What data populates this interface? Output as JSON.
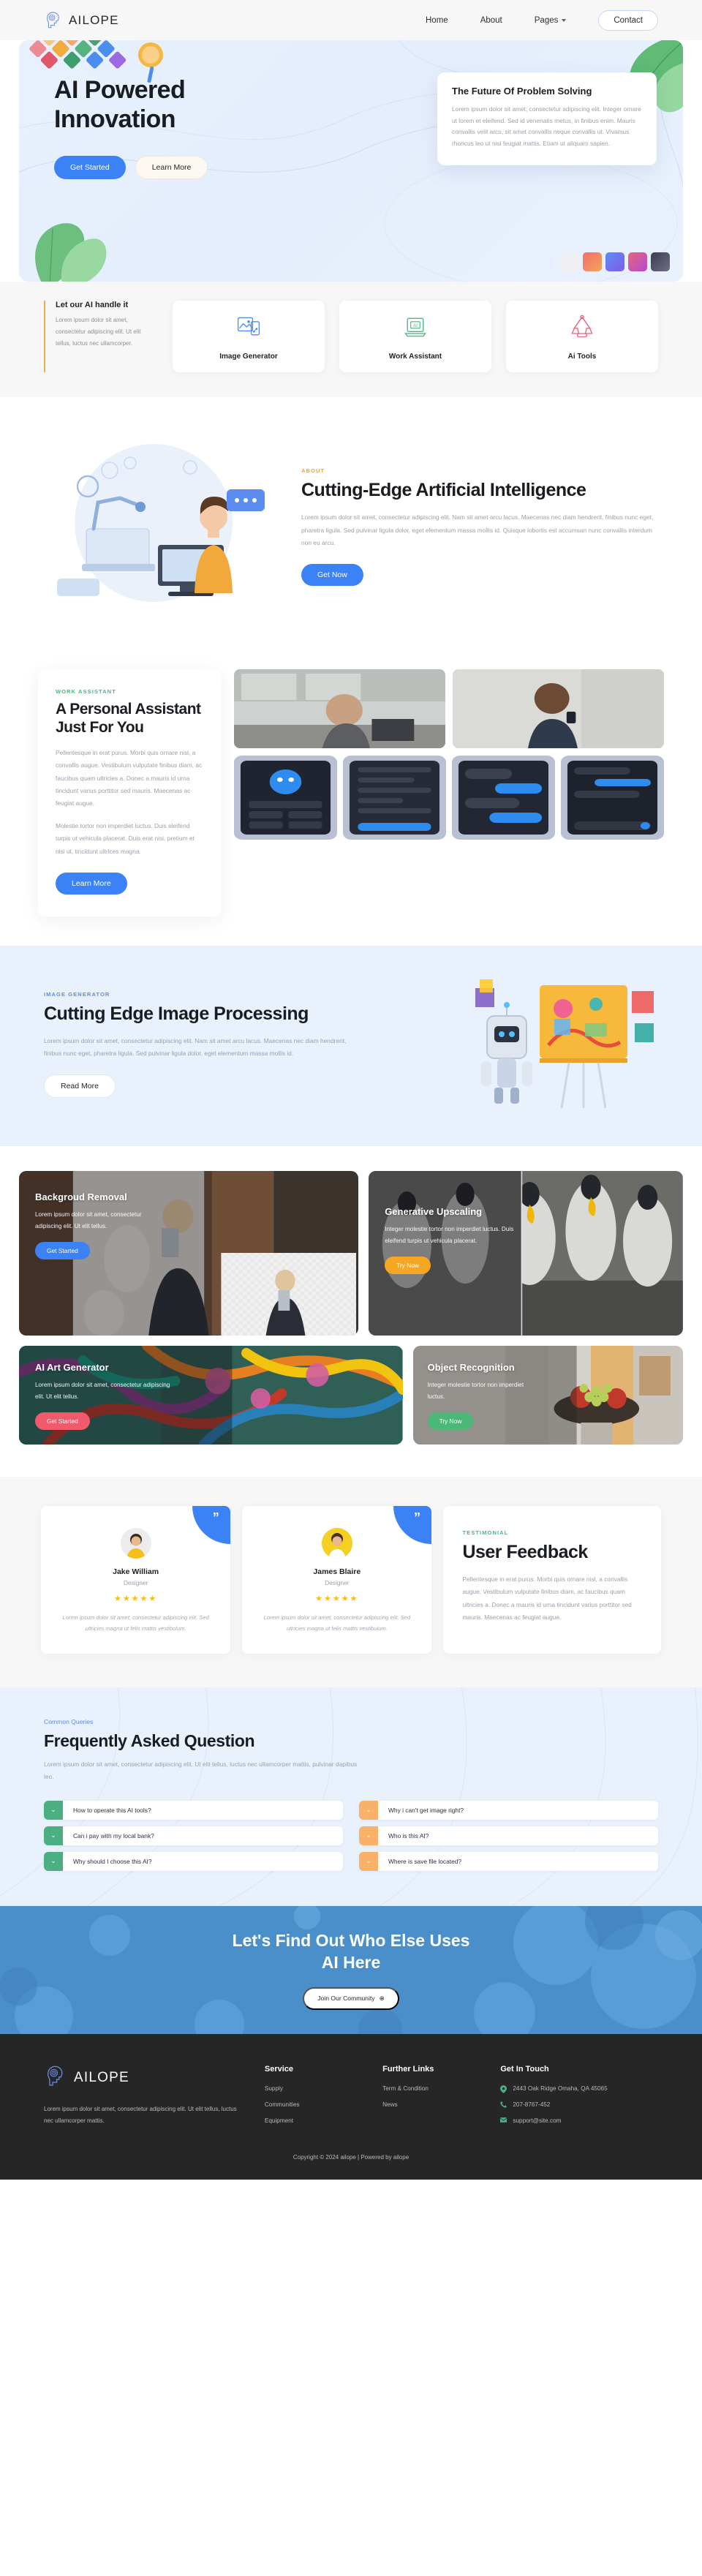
{
  "header": {
    "brand": "AILOPE",
    "nav": [
      {
        "label": "Home",
        "dropdown": false
      },
      {
        "label": "About",
        "dropdown": false
      },
      {
        "label": "Pages",
        "dropdown": true
      }
    ],
    "contact_label": "Contact"
  },
  "hero": {
    "title_line1": "AI Powered",
    "title_line2": "Innovation",
    "primary_btn": "Get Started",
    "secondary_btn": "Learn More",
    "card_title": "The Future Of Problem Solving",
    "card_text": "Lorem ipsum dolor sit amet, consectetur adipiscing elit. Integer ornare ut lorem et eleifend. Sed id venenatis metus, in finibus enim. Mauris convallis velit arcu, sit amet convallis neque convallis ut. Vivamus rhoncus leo ut nisi feugiat mattis. Etiam ut aliquam sapien."
  },
  "strip": {
    "heading": "Let our AI handle it",
    "text": "Lorem ipsum dolor sit amet, consectetur adipiscing elit. Ut elit tellus, luctus nec ullamcorper.",
    "cards": [
      {
        "label": "Image Generator",
        "icon": "image-generator-icon",
        "color": "#4f8ef0"
      },
      {
        "label": "Work Assistant",
        "icon": "work-assistant-icon",
        "color": "#46b97f"
      },
      {
        "label": "Ai Tools",
        "icon": "ai-tools-icon",
        "color": "#e8657f"
      }
    ]
  },
  "about": {
    "eyebrow": "ABOUT",
    "eyebrow_color": "#f5a623",
    "title": "Cutting-Edge Artificial Intelligence",
    "text": "Lorem ipsum dolor sit amet, consectetur adipiscing elit. Nam sit amet arcu lacus. Maecenas nec diam hendrerit, finibus nunc eget, pharetra ligula. Sed pulvinar ligula dolor, eget elementum massa mollis id. Quisque lobortis est accumsan nunc convallis interdum non eu arcu.",
    "button": "Get Now"
  },
  "assistant": {
    "eyebrow": "WORK ASSISTANT",
    "eyebrow_color": "#46b97f",
    "title": "A Personal Assistant Just For You",
    "p1": "Pellentesque in erat purus. Morbi quis ornare nisl, a convallis augue. Vestibulum vulputate finibus diam, ac faucibus quam ultricies a. Donec a mauris id urna tincidunt varius porttitor sed mauris. Maecenas ac feugiat augue.",
    "p2": "Molestie tortor non imperdiet luctus. Duis eleifend turpis ut vehicula placerat. Duis erat nisi, pretium et nisi ut, tincidunt ultrices magna.",
    "button": "Learn More"
  },
  "improc": {
    "eyebrow": "IMAGE GENERATOR",
    "eyebrow_color": "#5b8def",
    "title": "Cutting Edge Image Processing",
    "text": "Lorem ipsum dolor sit amet, consectetur adipiscing elit. Nam sit amet arcu lacus. Maecenas nec diam hendrerit, finibus nunc eget, pharetra ligula. Sed pulvinar ligula dolor, eget elementum massa mollis id.",
    "button": "Read More"
  },
  "showcase": [
    {
      "title": "Backgroud Removal",
      "text": "Lorem ipsum dolor sit amet, consectetur adipiscing elit. Ut elit tellus.",
      "button": "Get Started",
      "button_color": "#3b82f6",
      "image": "man-in-suit-sunglasses"
    },
    {
      "title": "Generative Upscaling",
      "text": "Integer molestie tortor non imperdiet luctus. Duis eleifend turpis ut vehicula placerat.",
      "button": "Try Now",
      "button_color": "#f5a623",
      "image": "king-penguins"
    },
    {
      "title": "AI Art Generator",
      "text": "Lorem ipsum dolor sit amet, consectetur adipiscing elit. Ut elit tellus.",
      "button": "Get Started",
      "button_color": "#ef5b6a",
      "image": "colorful-octopus-tentacles"
    },
    {
      "title": "Object Recognition",
      "text": "Integer molestie tortor non imperdiet luctus.",
      "button": "Try Now",
      "button_color": "#4cb877",
      "image": "fruit-bowl-on-table"
    }
  ],
  "testimonial": {
    "cards": [
      {
        "name": "Jake William",
        "role": "Designer",
        "stars": 5,
        "quote": "Lorem ipsum dolor sit amet, consectetur adipiscing elit. Sed ultricies magna ut felis mattis vestibulum.",
        "quote_mark": "”",
        "avatar": "avatar-man-yellow-shirt"
      },
      {
        "name": "James Blaire",
        "role": "Designer",
        "stars": 5,
        "quote": "Lorem ipsum dolor sit amet, consectetur adipiscing elit. Sed ultricies magna ut felis mattis vestibulum.",
        "quote_mark": "”",
        "avatar": "avatar-man-white-shirt"
      }
    ],
    "panel": {
      "eyebrow": "TESTIMONIAL",
      "eyebrow_color": "#46b97f",
      "title": "User Feedback",
      "text": "Pellentesque in erat purus. Morbi quis ornare nisl, a convallis augue. Vestibulum vulputate finibus diam, ac faucibus quam ultricies a. Donec a mauris id urna tincidunt varius porttitor sed mauris. Maecenas ac feugiat augue."
    }
  },
  "faq": {
    "eyebrow": "Common Queries",
    "eyebrow_color": "#5b8def",
    "title": "Frequently Asked Question",
    "subtitle": "Lorem ipsum dolor sit amet, consectetur adipiscing elit. Ut elit tellus, luctus nec ullamcorper mattis, pulvinar dapibus leo.",
    "left": [
      {
        "q": "How to operate this AI tools?",
        "toggle": "⌄",
        "color": "#4caf82"
      },
      {
        "q": "Can i pay with my local bank?",
        "toggle": "⌄",
        "color": "#4caf82"
      },
      {
        "q": "Why should I choose this AI?",
        "toggle": "⌄",
        "color": "#4caf82"
      }
    ],
    "right": [
      {
        "q": "Why i can't get image right?",
        "toggle": "⌄",
        "color": "#f8b濃"
      },
      {
        "q": "Who is this AI?",
        "toggle": "⌄",
        "color": "#f9b169"
      },
      {
        "q": "Where is save file located?",
        "toggle": "⌄",
        "color": "#f9b169"
      }
    ]
  },
  "cta": {
    "title_line1": "Let's Find Out Who Else Uses",
    "title_line2": "AI Here",
    "button": "Join Our Community",
    "button_icon": "⊕"
  },
  "footer": {
    "brand": "AILOPE",
    "about": "Lorem ipsum dolor sit amet, consectetur adipiscing elit. Ut elit tellus, luctus nec ullamcorper mattis.",
    "col1_title": "Service",
    "col1": [
      "Supply",
      "Communities",
      "Equipment"
    ],
    "col2_title": "Further Links",
    "col2": [
      "Term & Condition",
      "News"
    ],
    "contact_title": "Get In Touch",
    "address": "2443 Oak Ridge Omaha, QA 45065",
    "phone": "207-8767-452",
    "email": "support@site.com",
    "copyright": "Copyright © 2024 ailope | Powered by ailope"
  }
}
